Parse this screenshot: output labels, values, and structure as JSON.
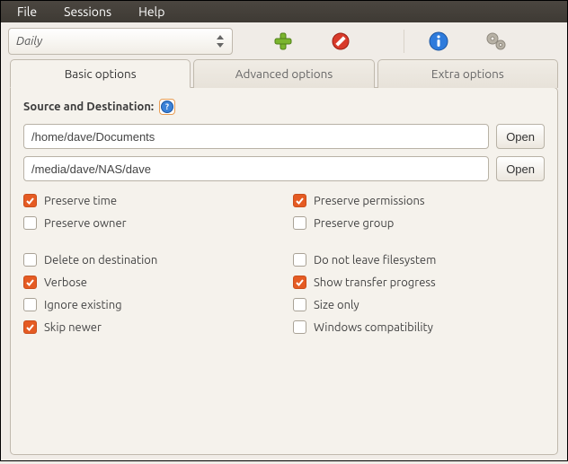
{
  "menubar": {
    "file": "File",
    "sessions": "Sessions",
    "help": "Help"
  },
  "toolbar": {
    "session_name": "Daily",
    "add_label": "Add",
    "forbid_label": "Cancel",
    "info_label": "Info",
    "prefs_label": "Preferences"
  },
  "tabs": {
    "basic": "Basic options",
    "advanced": "Advanced options",
    "extra": "Extra options"
  },
  "basic": {
    "section_title": "Source and Destination:",
    "source_path": "/home/dave/Documents",
    "dest_path": "/media/dave/NAS/dave",
    "open_label": "Open",
    "checks": {
      "preserve_time": {
        "label": "Preserve time",
        "checked": true
      },
      "preserve_permissions": {
        "label": "Preserve permissions",
        "checked": true
      },
      "preserve_owner": {
        "label": "Preserve owner",
        "checked": false
      },
      "preserve_group": {
        "label": "Preserve group",
        "checked": false
      },
      "delete_on_dest": {
        "label": "Delete on destination",
        "checked": false
      },
      "do_not_leave_fs": {
        "label": "Do not leave filesystem",
        "checked": false
      },
      "verbose": {
        "label": "Verbose",
        "checked": true
      },
      "show_progress": {
        "label": "Show transfer progress",
        "checked": true
      },
      "ignore_existing": {
        "label": "Ignore existing",
        "checked": false
      },
      "size_only": {
        "label": "Size only",
        "checked": false
      },
      "skip_newer": {
        "label": "Skip newer",
        "checked": true
      },
      "windows_compat": {
        "label": "Windows compatibility",
        "checked": false
      }
    }
  }
}
